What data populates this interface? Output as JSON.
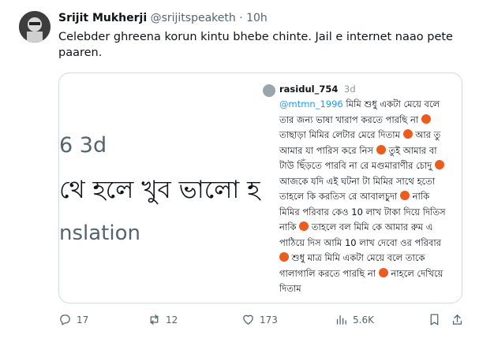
{
  "tweet": {
    "author_name": "Srijit Mukherji",
    "handle": "@srijitspeaketh",
    "separator": "·",
    "time": "10h",
    "text_line1": "Celebder ghreena korun kintu bhebe chinte. Jail e internet naao pete",
    "text_line2": "paaren."
  },
  "media": {
    "left_panel": {
      "time_fragment": "6 3d",
      "bengali_fragment": "থে হলে খুব ভালো হ",
      "translation_fragment": "nslation"
    },
    "quoted_reply": {
      "username": "rasidul_754",
      "time": "3d",
      "mention": "@mtmn_1996",
      "line1_rest": " মিমি শুধু একটা মেয়ে বলে",
      "line2": "তার জন্য ভাষা খারাপ করতে পারছি না",
      "line3": "তাছাড়া মিমির লেটার মেরে দিতাম",
      "line3b": " আর তু",
      "line4": "আমার যা পারিস করে নিস",
      "line4b": " তুই আমার বা",
      "line5": "টাউ ছিঁড়তে পারবি না রে মগুমারাণীর চোদু",
      "line6": "আজকে যদি এই ঘটনা টা মিমির সাথে হতো",
      "line7": "তাহলে কি করতিস রে আবালচুদা",
      "line7b": " নাকি",
      "line8": "মিমির পরিবার কেও 10 লাখ টাকা দিয়ে দিতিস",
      "line9": "নাকি",
      "line9b": " তাহলে বল মিমি কে আমার রুম এ",
      "line10": "পাঠিয়ে দিস আমি 10 লাখ দেবো ওর পরিবার",
      "line11": " শুধু মাত্র মিমি একটা মেয়ে বলে তাকে",
      "line12": "গালাগালি করতে পারছি না",
      "line12b": " নাহলে দেখিয়ে",
      "line13": "দিতাম"
    }
  },
  "actions": {
    "reply_count": "17",
    "retweet_count": "12",
    "like_count": "173",
    "views_count": "5.6K"
  },
  "colors": {
    "text": "#0f1419",
    "secondary": "#536471",
    "link": "#1d9bf0",
    "border": "#cfd9de",
    "emoji": "#ea5d1f"
  }
}
